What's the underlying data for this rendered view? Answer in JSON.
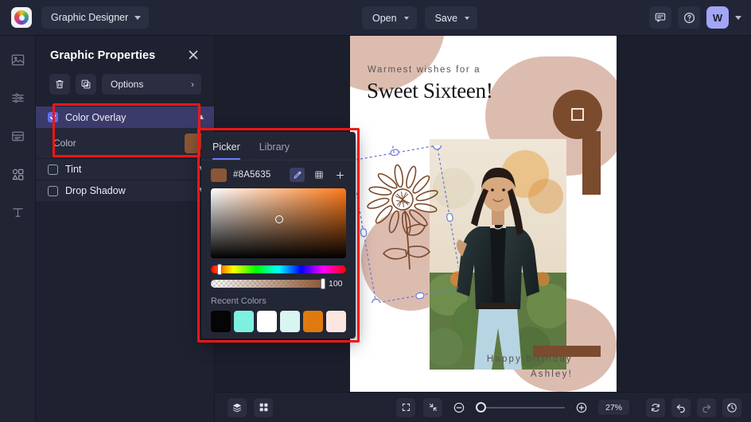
{
  "app": {
    "logo_icon": "color-wheel-logo",
    "workspace_name": "Graphic Designer"
  },
  "topbar": {
    "open_label": "Open",
    "save_label": "Save",
    "comment_icon": "comment-icon",
    "help_icon": "help-circle-icon",
    "avatar_initial": "W"
  },
  "rail": {
    "items": [
      {
        "icon": "image-icon",
        "name": "image"
      },
      {
        "icon": "adjustments-icon",
        "name": "adjustments"
      },
      {
        "icon": "layout-icon",
        "name": "layout"
      },
      {
        "icon": "shapes-icon",
        "name": "shapes"
      },
      {
        "icon": "text-icon",
        "name": "text"
      }
    ]
  },
  "panel": {
    "title": "Graphic Properties",
    "close_icon": "close-icon",
    "toolbar": {
      "delete_icon": "trash-icon",
      "duplicate_icon": "duplicate-icon",
      "options_label": "Options",
      "options_chevron": "chevron-right-icon"
    },
    "effects": [
      {
        "label": "Color Overlay",
        "checked": true,
        "expanded": true,
        "caret": "chevron-up-icon"
      },
      {
        "label": "Tint",
        "checked": false,
        "expanded": false,
        "caret": "chevron-down-icon"
      },
      {
        "label": "Drop Shadow",
        "checked": false,
        "expanded": false,
        "caret": "chevron-down-icon"
      }
    ],
    "color_row": {
      "label": "Color",
      "swatch_color": "#8A5635"
    }
  },
  "picker": {
    "tabs": [
      {
        "label": "Picker",
        "selected": true
      },
      {
        "label": "Library",
        "selected": false
      }
    ],
    "hex_value": "#8A5635",
    "swatch_color": "#8A5635",
    "tools": [
      {
        "icon": "eyedropper-icon",
        "highlighted": true
      },
      {
        "icon": "palette-grid-icon",
        "highlighted": false
      },
      {
        "icon": "plus-icon",
        "highlighted": false
      }
    ],
    "alpha_value": "100",
    "recent_colors_label": "Recent Colors",
    "recent_colors": [
      "#050505",
      "#7DF0E0",
      "#FFFFFF",
      "#D9F5F2",
      "#E07A10",
      "#FBE7E0"
    ]
  },
  "canvas": {
    "design": {
      "subtitle": "Warmest wishes for a",
      "title": "Sweet Sixteen!",
      "footer_line1": "Happy birthday",
      "footer_line2": "Ashley!",
      "accent_color": "#7B4B2D",
      "blob_color": "#DDBCB0",
      "selected_object": "flower-illustration"
    }
  },
  "bottombar": {
    "layers_icon": "layers-icon",
    "grid_icon": "grid-icon",
    "fit_icon": "fit-screen-icon",
    "shrink_icon": "collapse-icon",
    "zoom_out_icon": "zoom-out-icon",
    "zoom_in_icon": "zoom-in-icon",
    "zoom_level": "27%",
    "refresh_icon": "refresh-icon",
    "undo_icon": "undo-icon",
    "redo_icon": "redo-icon",
    "history_icon": "history-icon"
  }
}
